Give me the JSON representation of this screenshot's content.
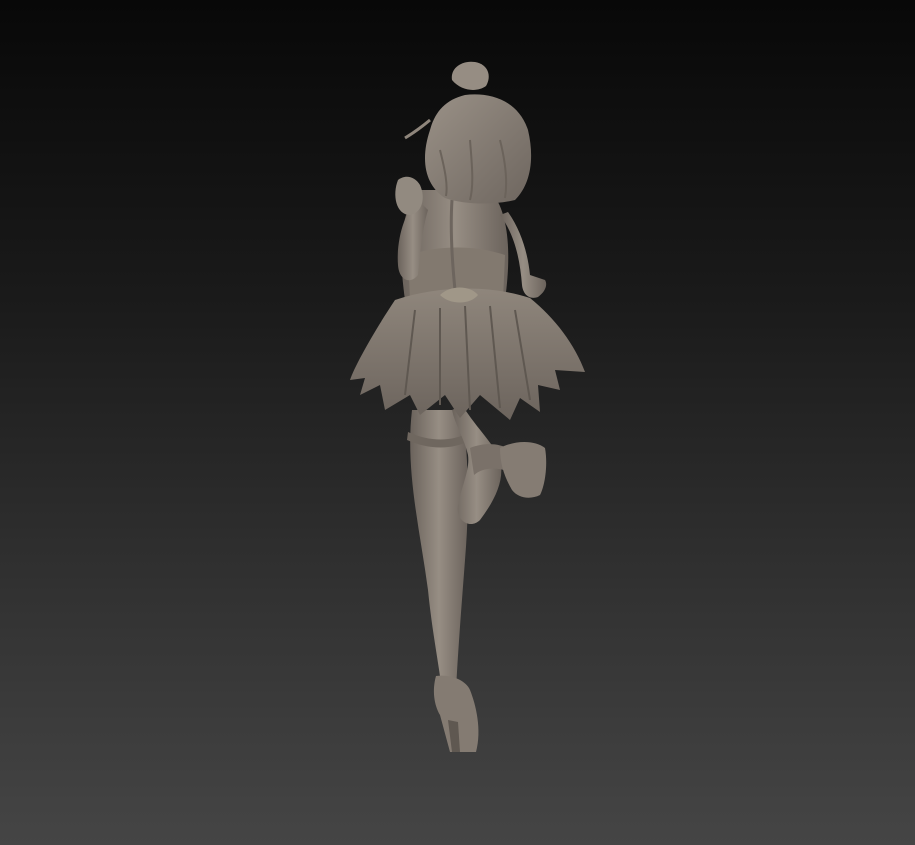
{
  "scene": {
    "subject": "figure-sculpt",
    "material_color": "#8a8178",
    "material_shadow": "#5c554f",
    "material_highlight": "#a79e94",
    "background_top": "#080808",
    "background_bottom": "#454545"
  }
}
